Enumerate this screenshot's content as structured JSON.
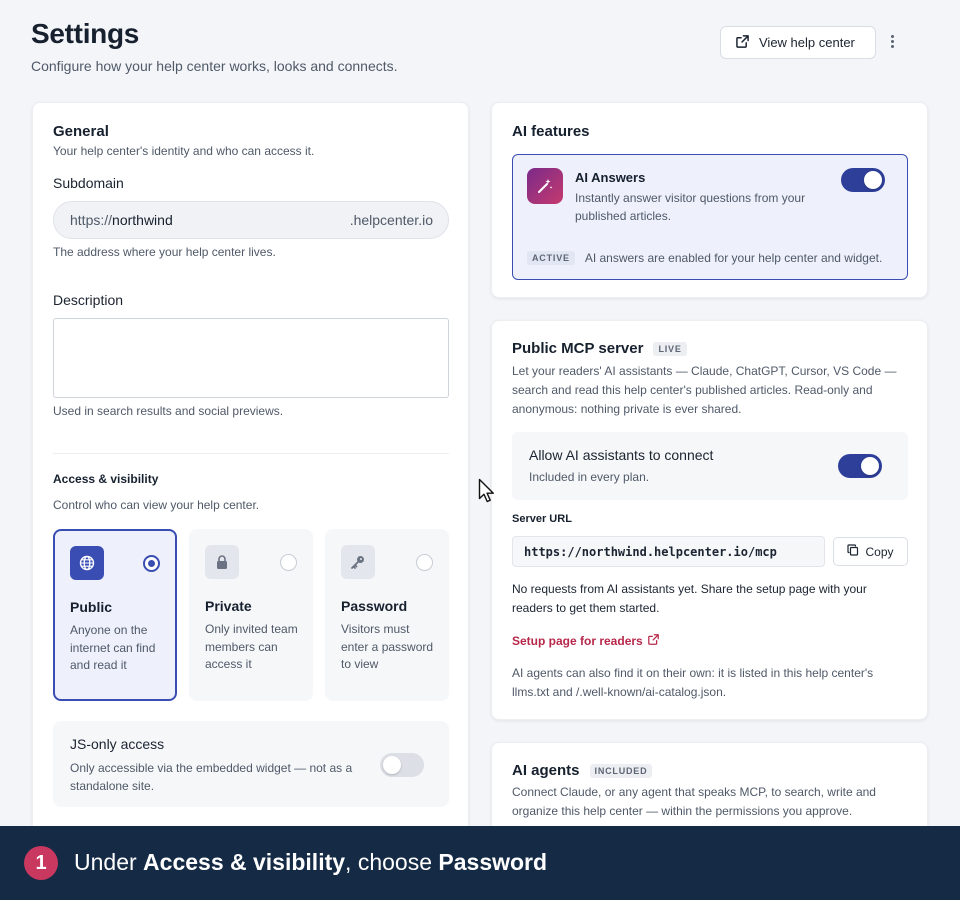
{
  "header": {
    "title": "Settings",
    "subtitle": "Configure how your help center works, looks and connects.",
    "view_button": "View help center"
  },
  "general": {
    "title": "General",
    "subtitle": "Your help center's identity and who can access it.",
    "subdomain_label": "Subdomain",
    "subdomain_prefix": "https://",
    "subdomain_value": "northwind",
    "subdomain_suffix": ".helpcenter.io",
    "subdomain_help": "The address where your help center lives.",
    "description_label": "Description",
    "description_value": "",
    "description_help": "Used in search results and social previews."
  },
  "access": {
    "title": "Access & visibility",
    "subtitle": "Control who can view your help center.",
    "options": [
      {
        "title": "Public",
        "desc": "Anyone on the internet can find and read it",
        "icon": "globe-icon",
        "selected": true
      },
      {
        "title": "Private",
        "desc": "Only invited team members can access it",
        "icon": "lock-icon",
        "selected": false
      },
      {
        "title": "Password",
        "desc": "Visitors must enter a password to view",
        "icon": "key-icon",
        "selected": false
      }
    ],
    "js_only_title": "JS-only access",
    "js_only_desc": "Only accessible via the embedded widget — not as a standalone site.",
    "js_only_enabled": false
  },
  "ai_features": {
    "title": "AI features",
    "answers_title": "AI Answers",
    "answers_desc": "Instantly answer visitor questions from your published articles.",
    "answers_enabled": true,
    "status_badge": "ACTIVE",
    "status_text": "AI answers are enabled for your help center and widget."
  },
  "mcp": {
    "title": "Public MCP server",
    "badge": "LIVE",
    "desc": "Let your readers' AI assistants — Claude, ChatGPT, Cursor, VS Code — search and read this help center's published articles. Read-only and anonymous: nothing private is ever shared.",
    "allow_title": "Allow AI assistants to connect",
    "allow_desc": "Included in every plan.",
    "allow_enabled": true,
    "url_label": "Server URL",
    "url_value": "https://northwind.helpcenter.io/mcp",
    "copy_label": "Copy",
    "no_requests": "No requests from AI assistants yet. Share the setup page with your readers to get them started.",
    "setup_link": "Setup page for readers",
    "footer_text": "AI agents can also find it on their own: it is listed in this help center's llms.txt and /.well-known/ai-catalog.json."
  },
  "agents": {
    "title": "AI agents",
    "badge": "INCLUDED",
    "desc": "Connect Claude, or any agent that speaks MCP, to search, write and organize this help center — within the permissions you approve."
  },
  "instruction": {
    "step": "1",
    "prefix": "Under ",
    "section": "Access & visibility",
    "middle": ", choose ",
    "target": "Password"
  },
  "colors": {
    "accent": "#3a4db3",
    "toggle_on": "#2e3f99",
    "link": "#b7284b",
    "bottom_bar": "#142a45"
  }
}
